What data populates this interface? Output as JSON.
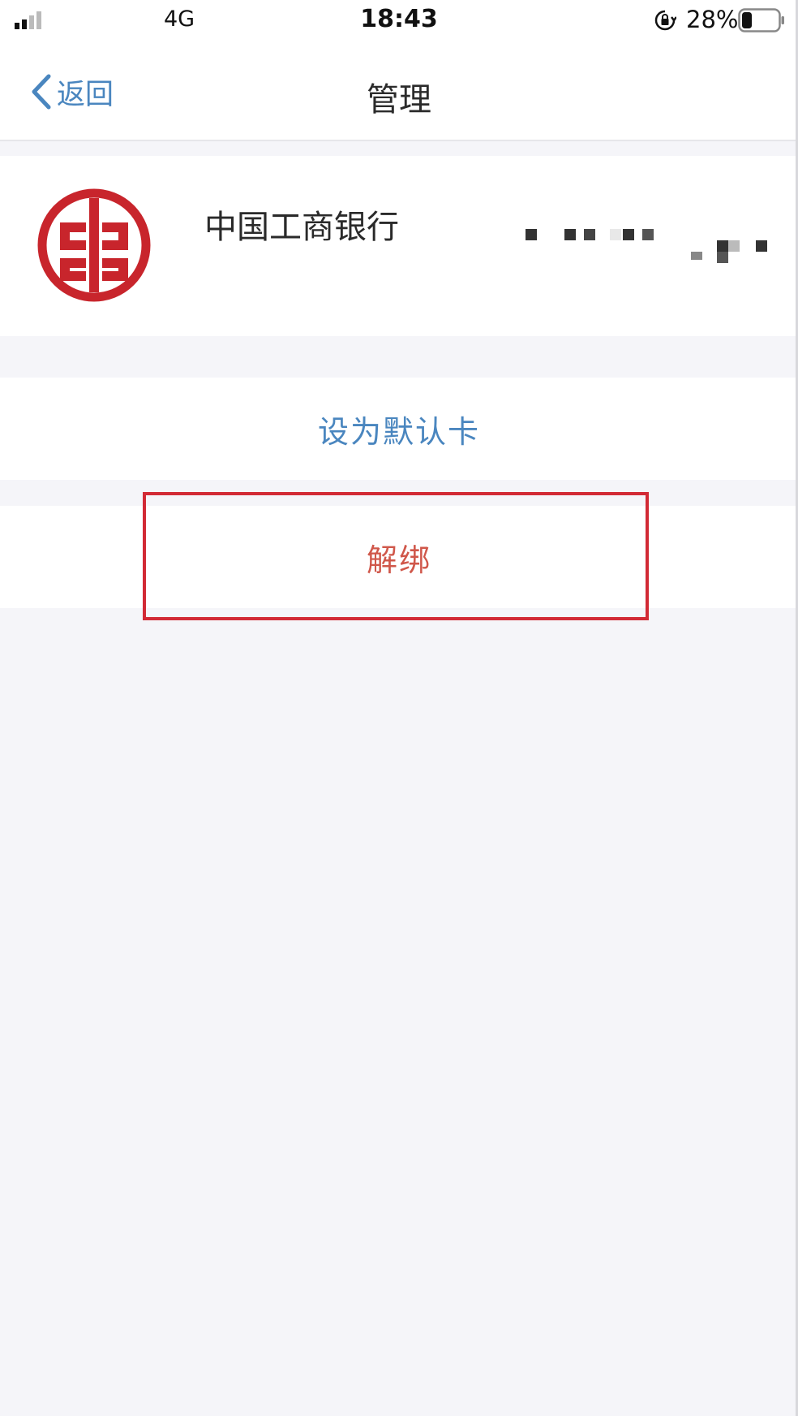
{
  "status_bar": {
    "carrier": "4G",
    "time": "18:43",
    "battery_percent": "28%",
    "battery_level": 0.28
  },
  "nav": {
    "back_label": "返回",
    "title": "管理"
  },
  "card": {
    "bank_name": "中国工商银行",
    "logo_color": "#c8252c",
    "number_obscured": true
  },
  "actions": {
    "set_default_label": "设为默认卡",
    "unbind_label": "解绑"
  },
  "colors": {
    "accent_blue": "#4a86bf",
    "danger_red": "#d0574a",
    "highlight_red": "#d22a35",
    "background": "#f5f5f9"
  }
}
